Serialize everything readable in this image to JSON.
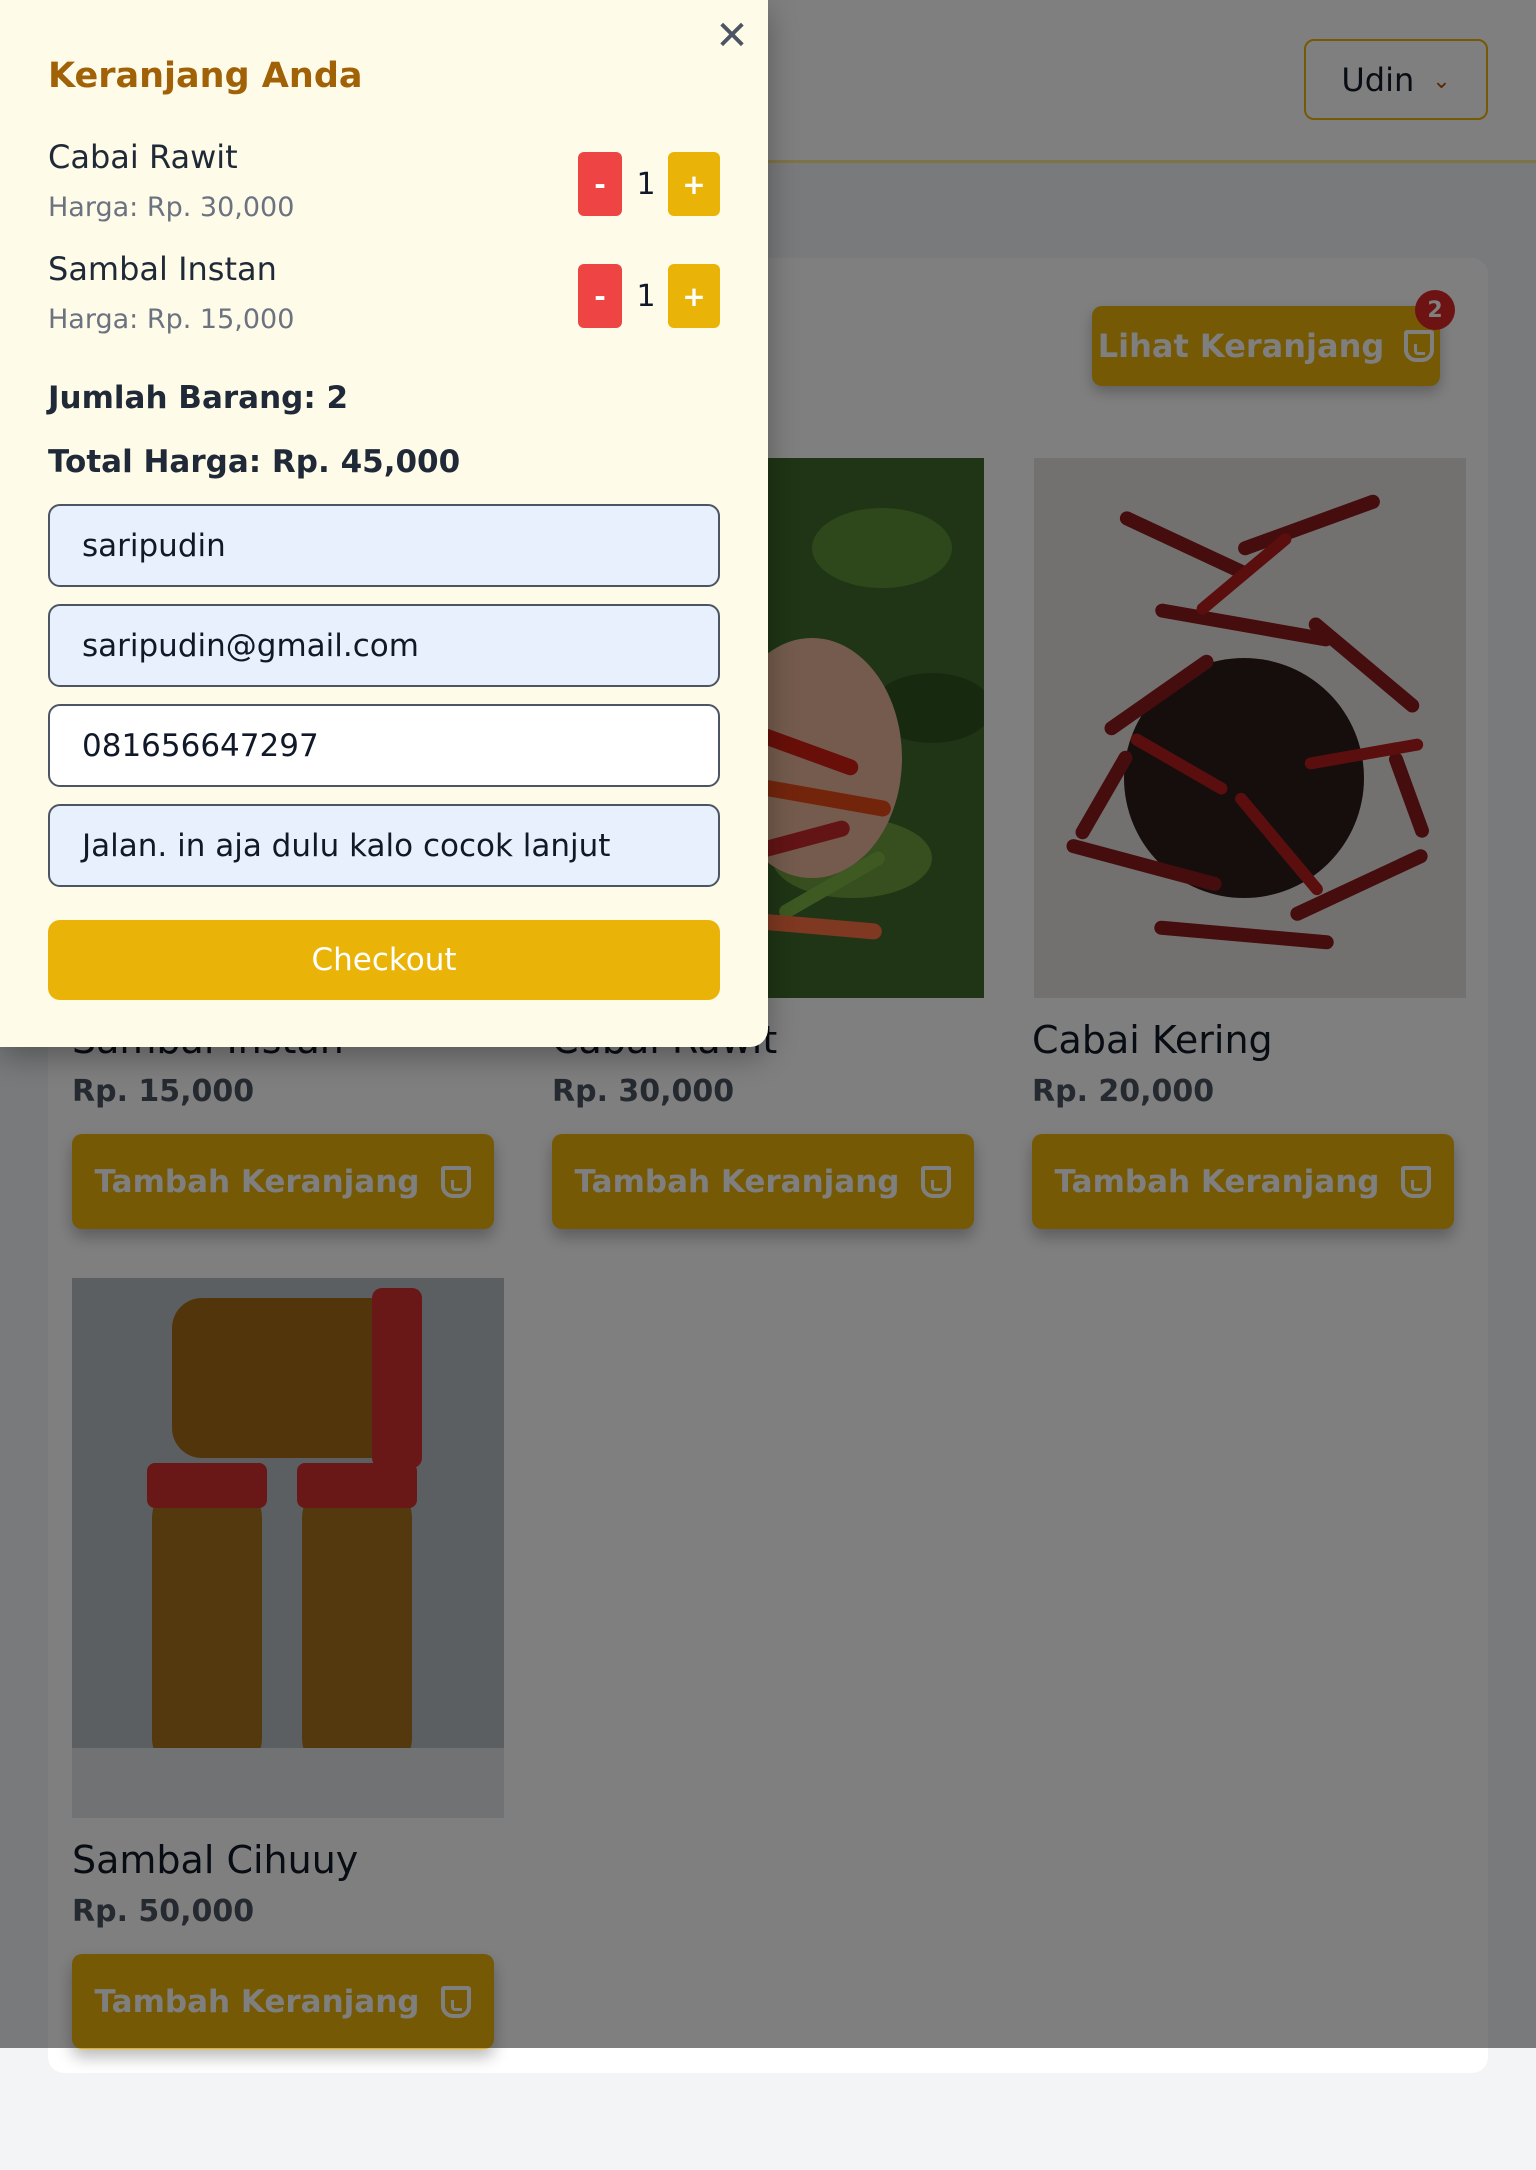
{
  "header": {
    "user_name": "Udin",
    "user_chevron": "chevron-down-icon"
  },
  "products_section": {
    "view_cart_label": "Lihat Keranjang",
    "cart_count": "2",
    "add_button_label": "Tambah Keranjang",
    "products": [
      {
        "name": "Sambal Instan",
        "price": "Rp. 15,000"
      },
      {
        "name": "Cabai Rawit",
        "price": "Rp. 30,000"
      },
      {
        "name": "Cabai Kering",
        "price": "Rp. 20,000"
      },
      {
        "name": "Sambal Cihuuy",
        "price": "Rp. 50,000"
      }
    ]
  },
  "cart_modal": {
    "title": "Keranjang Anda",
    "close_icon": "close-icon",
    "items": [
      {
        "name": "Cabai Rawit",
        "price_label": "Harga: Rp. 30,000",
        "qty": "1",
        "minus": "-",
        "plus": "+"
      },
      {
        "name": "Sambal Instan",
        "price_label": "Harga: Rp. 15,000",
        "qty": "1",
        "minus": "-",
        "plus": "+"
      }
    ],
    "total_items": "Jumlah Barang: 2",
    "total_price": "Total Harga: Rp. 45,000",
    "form": {
      "name": "saripudin",
      "email": "saripudin@gmail.com",
      "phone": "081656647297",
      "address": "Jalan. in aja dulu kalo cocok lanjut"
    },
    "checkout_label": "Checkout"
  },
  "colors": {
    "accent": "#eab308",
    "danger": "#ef4444",
    "modal_bg": "#fefbe8",
    "title": "#a16207"
  }
}
